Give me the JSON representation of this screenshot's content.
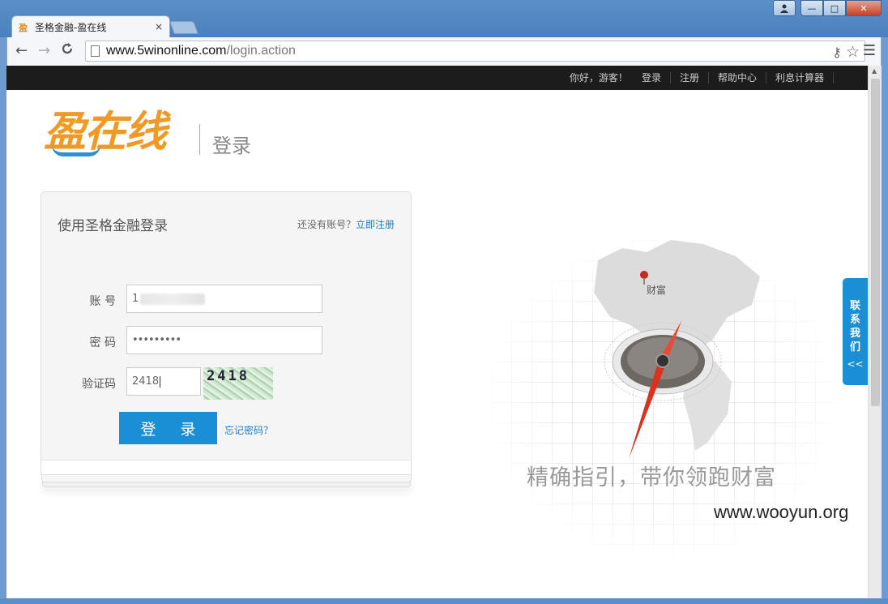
{
  "browser": {
    "tab_title": "圣格金融-盈在线",
    "tab_close": "×",
    "url_host": "www.5winonline.com",
    "url_path": "/login.action",
    "back_icon": "←",
    "forward_icon": "→",
    "reload_icon": "C",
    "star_icon": "☆",
    "key_icon": "⚷",
    "menu_icon": "☰",
    "win_user_icon": "👤",
    "win_min": "—",
    "win_max": "□",
    "win_close": "✕"
  },
  "topnav": {
    "greeting": "你好，游客！",
    "login": "登录",
    "register": "注册",
    "help": "帮助中心",
    "calculator": "利息计算器"
  },
  "logo": {
    "text": "盈在线",
    "subtitle": "登录"
  },
  "login_card": {
    "title": "使用圣格金融登录",
    "no_account": "还没有账号？",
    "register_now": "立即注册",
    "account_label": "账 号",
    "account_value": "1",
    "password_label": "密 码",
    "password_value": "•••••••••",
    "captcha_label": "验证码",
    "captcha_value": "2418",
    "captcha_image_text": "2418",
    "login_button": "登 录",
    "forgot_password": "忘记密码？"
  },
  "hero": {
    "pin_label": "财富",
    "slogan": "精确指引，带你领跑财富"
  },
  "contact": {
    "label_chars": [
      "联",
      "系",
      "我",
      "们"
    ],
    "chevron": "<<"
  },
  "watermark": "www.wooyun.org",
  "colors": {
    "accent_blue": "#1a8fd6",
    "logo_orange": "#f09a26",
    "topbar": "#1c1c1c"
  }
}
